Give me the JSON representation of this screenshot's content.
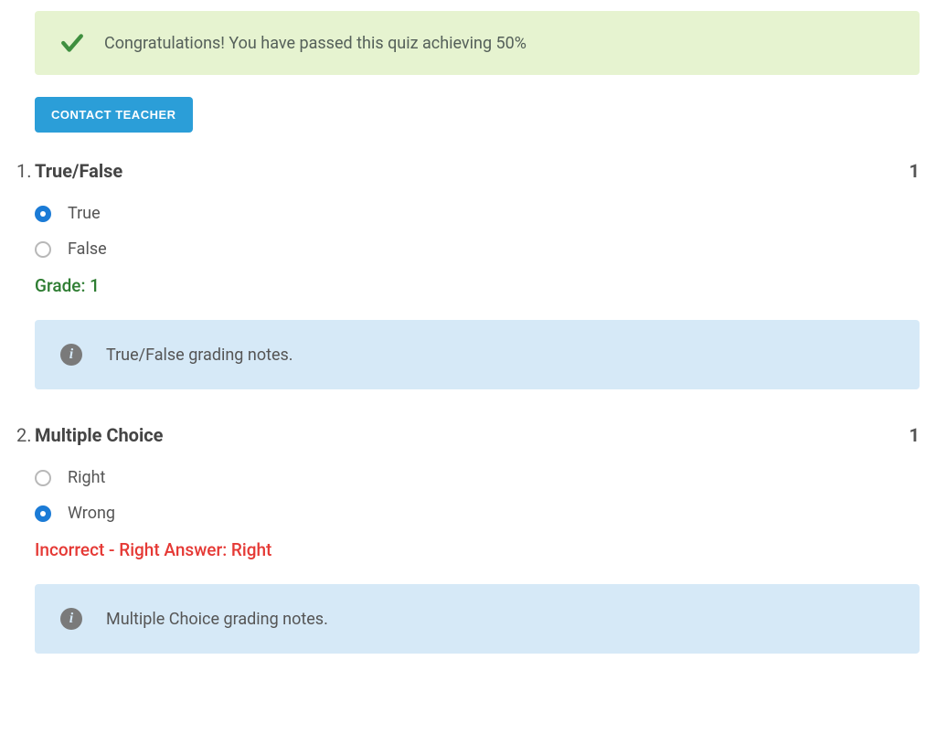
{
  "banner": {
    "message": "Congratulations! You have passed this quiz achieving 50%"
  },
  "contact_button_label": "CONTACT TEACHER",
  "questions": [
    {
      "number": "1.",
      "title": "True/False",
      "points": "1",
      "options": [
        {
          "label": "True",
          "selected": true
        },
        {
          "label": "False",
          "selected": false
        }
      ],
      "result_text": "Grade: 1",
      "result_state": "correct",
      "note": "True/False grading notes."
    },
    {
      "number": "2.",
      "title": "Multiple Choice",
      "points": "1",
      "options": [
        {
          "label": "Right",
          "selected": false
        },
        {
          "label": "Wrong",
          "selected": true
        }
      ],
      "result_text": "Incorrect - Right Answer: Right",
      "result_state": "incorrect",
      "note": "Multiple Choice grading notes."
    }
  ]
}
